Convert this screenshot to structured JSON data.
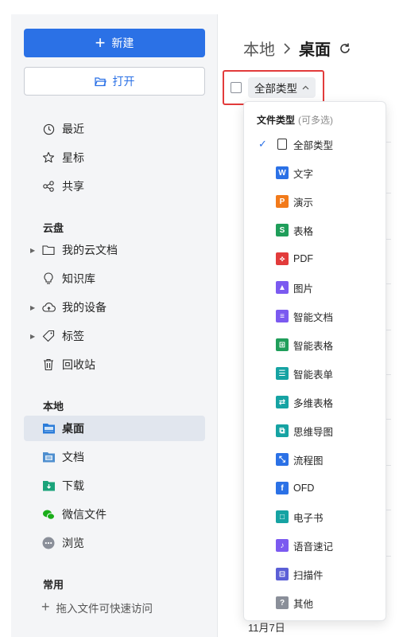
{
  "sidebar": {
    "new_label": "新建",
    "open_label": "打开",
    "recent": [
      {
        "label": "最近",
        "icon": "clock-icon"
      },
      {
        "label": "星标",
        "icon": "star-icon"
      },
      {
        "label": "共享",
        "icon": "share-icon"
      }
    ],
    "cloud_title": "云盘",
    "cloud": [
      {
        "label": "我的云文档",
        "icon": "folder-icon",
        "expandable": true
      },
      {
        "label": "知识库",
        "icon": "bulb-icon",
        "expandable": false
      },
      {
        "label": "我的设备",
        "icon": "cloud-upload-icon",
        "expandable": true
      },
      {
        "label": "标签",
        "icon": "tag-icon",
        "expandable": true
      },
      {
        "label": "回收站",
        "icon": "trash-icon",
        "expandable": false
      }
    ],
    "local_title": "本地",
    "local": [
      {
        "label": "桌面",
        "icon": "desktop-folder-icon",
        "active": true
      },
      {
        "label": "文档",
        "icon": "documents-folder-icon"
      },
      {
        "label": "下载",
        "icon": "download-folder-icon"
      },
      {
        "label": "微信文件",
        "icon": "wechat-icon"
      },
      {
        "label": "浏览",
        "icon": "more-icon"
      }
    ],
    "common_title": "常用",
    "quick_tip": "拖入文件可快速访问"
  },
  "main": {
    "breadcrumb_root": "本地",
    "breadcrumb_current": "桌面",
    "filter_label": "全部类型"
  },
  "dropdown": {
    "header": "文件类型",
    "header_hint": "(可多选)",
    "items": [
      {
        "label": "全部类型",
        "icon": "all-types-icon",
        "color": "#ffffff",
        "checked": true
      },
      {
        "label": "文字",
        "icon": "word-icon",
        "color": "#2b71e6",
        "glyph": "W"
      },
      {
        "label": "演示",
        "icon": "presentation-icon",
        "color": "#f27a1a",
        "glyph": "P"
      },
      {
        "label": "表格",
        "icon": "spreadsheet-icon",
        "color": "#1f9e5a",
        "glyph": "S"
      },
      {
        "label": "PDF",
        "icon": "pdf-icon",
        "color": "#e23b3b",
        "glyph": "⟡"
      },
      {
        "label": "图片",
        "icon": "image-icon",
        "color": "#7b5af0",
        "glyph": "▲"
      },
      {
        "label": "智能文档",
        "icon": "smart-doc-icon",
        "color": "#7b5af0",
        "glyph": "≡"
      },
      {
        "label": "智能表格",
        "icon": "smart-sheet-icon",
        "color": "#1f9e5a",
        "glyph": "⊞"
      },
      {
        "label": "智能表单",
        "icon": "smart-form-icon",
        "color": "#16a3a3",
        "glyph": "☰"
      },
      {
        "label": "多维表格",
        "icon": "multi-table-icon",
        "color": "#16a3a3",
        "glyph": "⇄"
      },
      {
        "label": "思维导图",
        "icon": "mind-map-icon",
        "color": "#16a3a3",
        "glyph": "⧉"
      },
      {
        "label": "流程图",
        "icon": "flowchart-icon",
        "color": "#2b71e6",
        "glyph": "⤡"
      },
      {
        "label": "OFD",
        "icon": "ofd-icon",
        "color": "#2b71e6",
        "glyph": "f"
      },
      {
        "label": "电子书",
        "icon": "ebook-icon",
        "color": "#16a3a3",
        "glyph": "□"
      },
      {
        "label": "语音速记",
        "icon": "voice-note-icon",
        "color": "#7b5af0",
        "glyph": "♪"
      },
      {
        "label": "扫描件",
        "icon": "scan-icon",
        "color": "#5b5fd6",
        "glyph": "⊟"
      },
      {
        "label": "其他",
        "icon": "other-icon",
        "color": "#8a8f99",
        "glyph": "?"
      }
    ]
  },
  "bottom_stub": "11月7日"
}
